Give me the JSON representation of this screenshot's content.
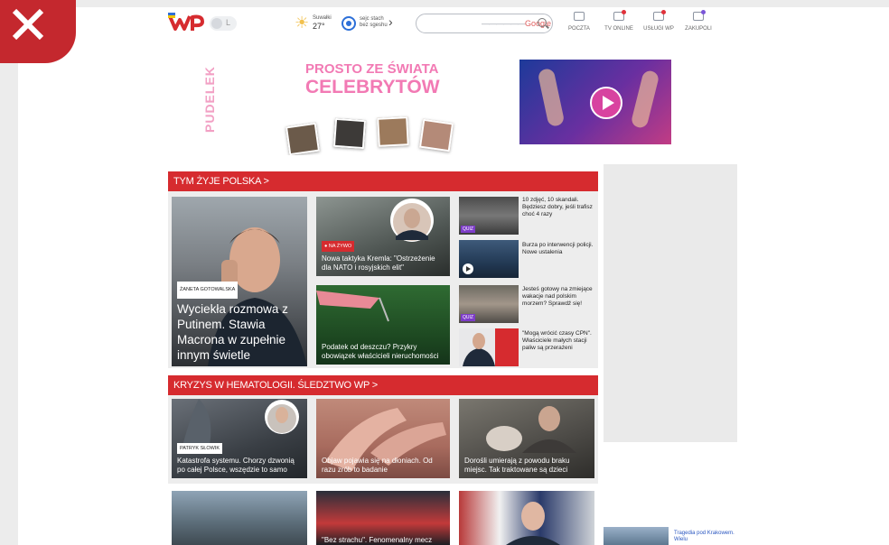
{
  "header": {
    "toggle_label": "L",
    "weather": {
      "city": "Suwałki",
      "temperature": "27°",
      "air_line1": "sejc stach",
      "air_line2": "bez sgeshu"
    },
    "search": {
      "placeholder": "",
      "brand": "Google"
    },
    "services": [
      {
        "label": "POCZTA",
        "icon": "mail-icon"
      },
      {
        "label": "TV ONLINE",
        "icon": "tv-icon"
      },
      {
        "label": "USŁUGI WP",
        "icon": "services-icon"
      },
      {
        "label": "ZAKUPOLI",
        "icon": "shopping-icon"
      }
    ]
  },
  "ad": {
    "side_text": "PUDELEK",
    "headline1": "PROSTO ZE ŚWIATA",
    "headline2": "CELEBRYTÓW"
  },
  "sections": [
    {
      "title": "TYM ŻYJE POLSKA >",
      "main": {
        "tag": "ŻANETA GOTOWALSKA",
        "title": "Wyciekła rozmowa z Putinem. Stawia Macrona w zupełnie innym świetle"
      },
      "mid": [
        {
          "badge": "● NA ŻYWO",
          "title": "Nowa taktyka Kremla: \"Ostrzeżenie dla NATO i rosyjskich elit\""
        },
        {
          "title": "Podatek od deszczu? Przykry obowiązek właścicieli nieruchomości"
        }
      ],
      "side": [
        {
          "title": "10 zdjęć, 10 skandali. Będziesz dobry, jeśli trafisz choć 4 razy",
          "badge": "QUIZ"
        },
        {
          "title": "Burza po interwencji policji. Nowe ustalenia",
          "badge": ""
        },
        {
          "title": "Jesteś gotowy na zmiejące wakacje nad polskim morzem? Sprawdź się!",
          "badge": "QUIZ"
        },
        {
          "title": "\"Mogą wrócić czasy CPN\". Właściciele małych stacji paliw są przerażeni",
          "badge": ""
        }
      ]
    },
    {
      "title": "KRYZYS W HEMATOLOGII. ŚLEDZTWO WP >",
      "cards": [
        {
          "tag": "PATRYK SŁOWIK",
          "title": "Katastrofa systemu. Chorzy dzwonią po całej Polsce, wszędzie to samo"
        },
        {
          "tag": "",
          "title": "Objaw pojawia się na dłoniach. Od razu zrób to badanie"
        },
        {
          "tag": "",
          "title": "Dorośli umierają z powodu braku miejsc. Tak traktowane są dzieci"
        }
      ]
    }
  ],
  "bottom_row": [
    {
      "title": ""
    },
    {
      "title": "\"Bez strachu\". Fenomenalny mecz"
    },
    {
      "title": ""
    }
  ],
  "sidebar_news": {
    "title": "Tragedia pod Krakowem. Wielu"
  }
}
